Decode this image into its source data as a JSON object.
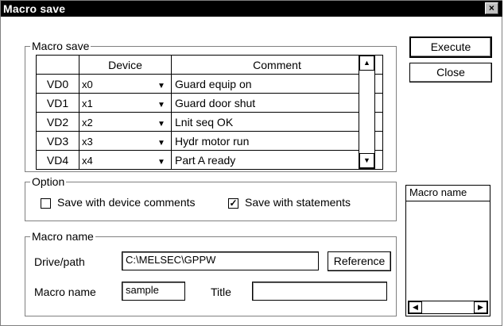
{
  "window": {
    "title": "Macro save",
    "close_glyph": "×"
  },
  "macro_save_group": {
    "label": "Macro save",
    "columns": [
      "Device",
      "Comment"
    ],
    "rows": [
      {
        "id": "VD0",
        "device": "x0",
        "comment": "Guard equip on"
      },
      {
        "id": "VD1",
        "device": "x1",
        "comment": "Guard door shut"
      },
      {
        "id": "VD2",
        "device": "x2",
        "comment": "Lnit seq OK"
      },
      {
        "id": "VD3",
        "device": "x3",
        "comment": "Hydr motor run"
      },
      {
        "id": "VD4",
        "device": "x4",
        "comment": "Part A ready"
      }
    ]
  },
  "buttons": {
    "execute": "Execute",
    "close": "Close",
    "reference": "Reference"
  },
  "option_group": {
    "label": "Option",
    "save_with_device_comments": {
      "label": "Save with device comments",
      "checked": false
    },
    "save_with_statements": {
      "label": "Save with statements",
      "checked": true
    }
  },
  "macro_name_group": {
    "label": "Macro name",
    "drive_path_label": "Drive/path",
    "drive_path_value": "C:\\MELSEC\\GPPW",
    "macro_name_label": "Macro name",
    "macro_name_value": "sample",
    "title_label": "Title",
    "title_value": ""
  },
  "macro_list": {
    "header": "Macro name"
  },
  "glyphs": {
    "check": "✓",
    "dropdown": "▼",
    "up": "▲",
    "down": "▼",
    "left": "◀",
    "right": "▶"
  }
}
